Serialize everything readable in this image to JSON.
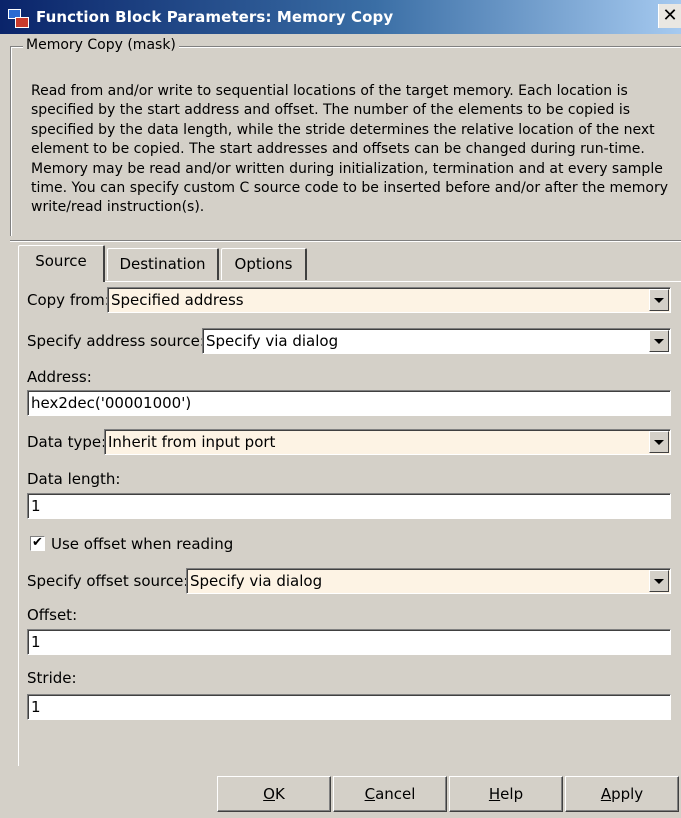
{
  "window": {
    "title": "Function Block Parameters: Memory Copy",
    "close_glyph": "✕"
  },
  "mask": {
    "legend": "Memory Copy (mask)",
    "description": "Read from and/or write to sequential locations of the target memory. Each location is specified by the start address and offset. The number of the elements to be copied is specified by the data length, while the stride determines the relative location of the next element to be copied. The start addresses and offsets can be changed during run-time. Memory may be read and/or written during initialization, termination and at every sample time. You can specify custom C source code to be inserted before and/or after the memory write/read instruction(s)."
  },
  "tabs": [
    {
      "label": "Source",
      "active": true
    },
    {
      "label": "Destination",
      "active": false
    },
    {
      "label": "Options",
      "active": false
    }
  ],
  "form": {
    "copy_from_label": "Copy from:",
    "copy_from_value": "Specified address",
    "address_source_label": "Specify address source:",
    "address_source_value": "Specify via dialog",
    "address_label": "Address:",
    "address_value": "hex2dec('00001000')",
    "data_type_label": "Data type:",
    "data_type_value": "Inherit from input port",
    "data_length_label": "Data length:",
    "data_length_value": "1",
    "use_offset_label": "Use offset when reading",
    "use_offset_checked": true,
    "offset_source_label": "Specify offset source:",
    "offset_source_value": "Specify via dialog",
    "offset_label": "Offset:",
    "offset_value": "1",
    "stride_label": "Stride:",
    "stride_value": "1"
  },
  "buttons": {
    "ok": {
      "mnemonic": "O",
      "rest": "K"
    },
    "cancel": {
      "mnemonic": "C",
      "rest": "ancel"
    },
    "help": {
      "mnemonic": "H",
      "rest": "elp"
    },
    "apply": {
      "mnemonic": "A",
      "rest": "pply"
    }
  },
  "colors": {
    "title_gradient_start": "#0a246a",
    "title_gradient_end": "#a6caf0",
    "dialog_bg": "#d4d0c8",
    "combo_highlight": "#fdf3e4"
  },
  "icons": {
    "app": "simulink-block-icon",
    "close": "close-icon",
    "dropdown": "chevron-down-icon",
    "check": "checkmark-icon"
  }
}
